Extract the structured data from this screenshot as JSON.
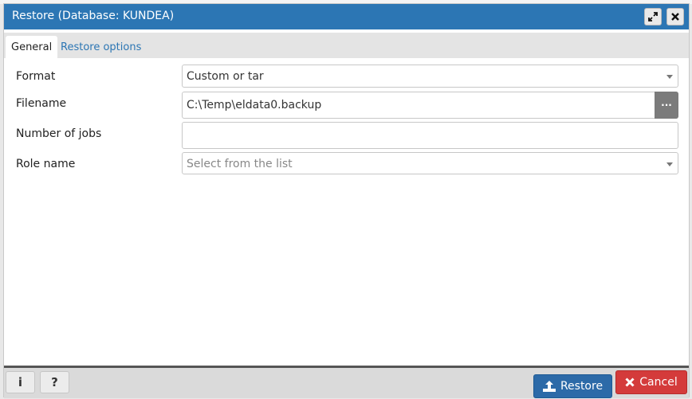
{
  "dialog": {
    "title": "Restore (Database: KUNDEA)",
    "maximize_icon": "expand-arrows-icon",
    "close_icon": "close-icon"
  },
  "tabs": [
    {
      "label": "General",
      "active": true
    },
    {
      "label": "Restore options",
      "active": false
    }
  ],
  "form": {
    "format": {
      "label": "Format",
      "value": "Custom or tar"
    },
    "filename": {
      "label": "Filename",
      "value": "C:\\Temp\\eldata0.backup",
      "browse_label": "···"
    },
    "jobs": {
      "label": "Number of jobs",
      "value": ""
    },
    "role": {
      "label": "Role name",
      "placeholder": "Select from the list"
    }
  },
  "footer": {
    "info_label": "i",
    "help_label": "?",
    "restore_label": "Restore",
    "cancel_label": "Cancel"
  }
}
